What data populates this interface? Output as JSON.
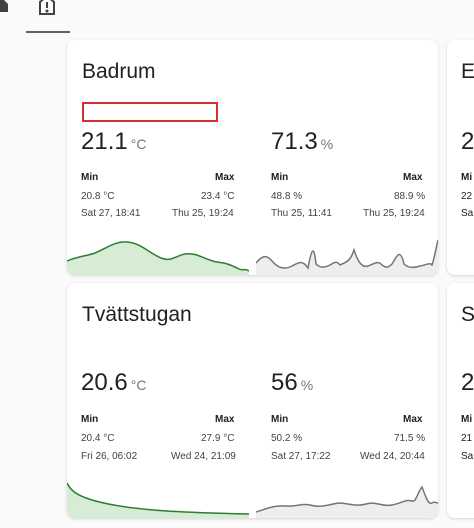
{
  "cards": [
    {
      "title": "Badrum",
      "sensors": [
        {
          "value": "21.1",
          "unit": "°C",
          "min_label": "Min",
          "max_label": "Max",
          "min_value": "20.8 °C",
          "max_value": "23.4 °C",
          "min_time": "Sat 27, 18:41",
          "max_time": "Thu 25, 19:24"
        },
        {
          "value": "71.3",
          "unit": "%",
          "min_label": "Min",
          "max_label": "Max",
          "min_value": "48.8 %",
          "max_value": "88.9 %",
          "min_time": "Thu 25, 11:41",
          "max_time": "Thu 25, 19:24"
        }
      ]
    },
    {
      "title": "Tvättstugan",
      "sensors": [
        {
          "value": "20.6",
          "unit": "°C",
          "min_label": "Min",
          "max_label": "Max",
          "min_value": "20.4 °C",
          "max_value": "27.9 °C",
          "min_time": "Fri 26, 06:02",
          "max_time": "Wed 24, 21:09"
        },
        {
          "value": "56",
          "unit": "%",
          "min_label": "Min",
          "max_label": "Max",
          "min_value": "50.2 %",
          "max_value": "71.5 %",
          "min_time": "Sat 27, 17:22",
          "max_time": "Wed 24, 20:44"
        }
      ]
    }
  ],
  "partial_cards": [
    {
      "title_fragment": "E",
      "value_fragment": "2",
      "label_fragment": "Mi",
      "line1": "22",
      "line2": "Sa"
    },
    {
      "title_fragment": "S",
      "value_fragment": "2",
      "label_fragment": "Mi",
      "line1": "21",
      "line2": "Sa"
    }
  ],
  "colors": {
    "temperature_line": "#2e7d32",
    "temperature_fill": "#d7ecd5",
    "humidity_line": "#757575",
    "humidity_fill": "#eeeeee",
    "highlight": "#d32f2f"
  }
}
